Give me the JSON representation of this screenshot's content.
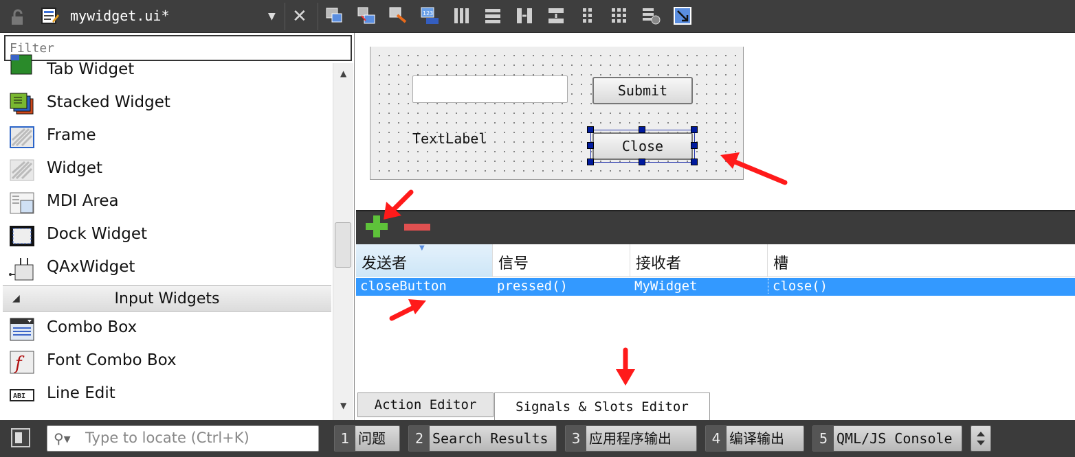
{
  "topbar": {
    "document_title": "mywidget.ui*",
    "close_glyph": "✕"
  },
  "widget_box": {
    "filter_placeholder": "Filter",
    "items_top": [
      {
        "label": "Tab Widget",
        "icon": "tab-widget-icon"
      },
      {
        "label": "Stacked Widget",
        "icon": "stacked-widget-icon"
      },
      {
        "label": "Frame",
        "icon": "frame-icon"
      },
      {
        "label": "Widget",
        "icon": "widget-icon"
      },
      {
        "label": "MDI Area",
        "icon": "mdi-area-icon"
      },
      {
        "label": "Dock Widget",
        "icon": "dock-widget-icon"
      },
      {
        "label": "QAxWidget",
        "icon": "qaxwidget-icon"
      }
    ],
    "category": "Input Widgets",
    "items_bottom": [
      {
        "label": "Combo Box",
        "icon": "combo-box-icon"
      },
      {
        "label": "Font Combo Box",
        "icon": "font-combo-box-icon"
      },
      {
        "label": "Line Edit",
        "icon": "line-edit-icon"
      }
    ]
  },
  "form": {
    "submit_label": "Submit",
    "close_label": "Close",
    "text_label": "TextLabel"
  },
  "signal_slot_editor": {
    "columns": [
      "发送者",
      "信号",
      "接收者",
      "槽"
    ],
    "rows": [
      {
        "sender": "closeButton",
        "signal": "pressed()",
        "receiver": "MyWidget",
        "slot": "close()"
      }
    ]
  },
  "editor_tabs": {
    "action_editor": "Action Editor",
    "signals_slots_editor": "Signals & Slots Editor"
  },
  "statusbar": {
    "locate_placeholder": "Type to locate (Ctrl+K)",
    "panes": [
      {
        "num": "1",
        "label": "问题"
      },
      {
        "num": "2",
        "label": "Search Results"
      },
      {
        "num": "3",
        "label": "应用程序输出"
      },
      {
        "num": "4",
        "label": "编译输出"
      },
      {
        "num": "5",
        "label": "QML/JS Console"
      }
    ]
  },
  "colors": {
    "selection": "#3399ff",
    "annotation_arrow": "#ff1a1a",
    "handle": "#001a9e"
  }
}
